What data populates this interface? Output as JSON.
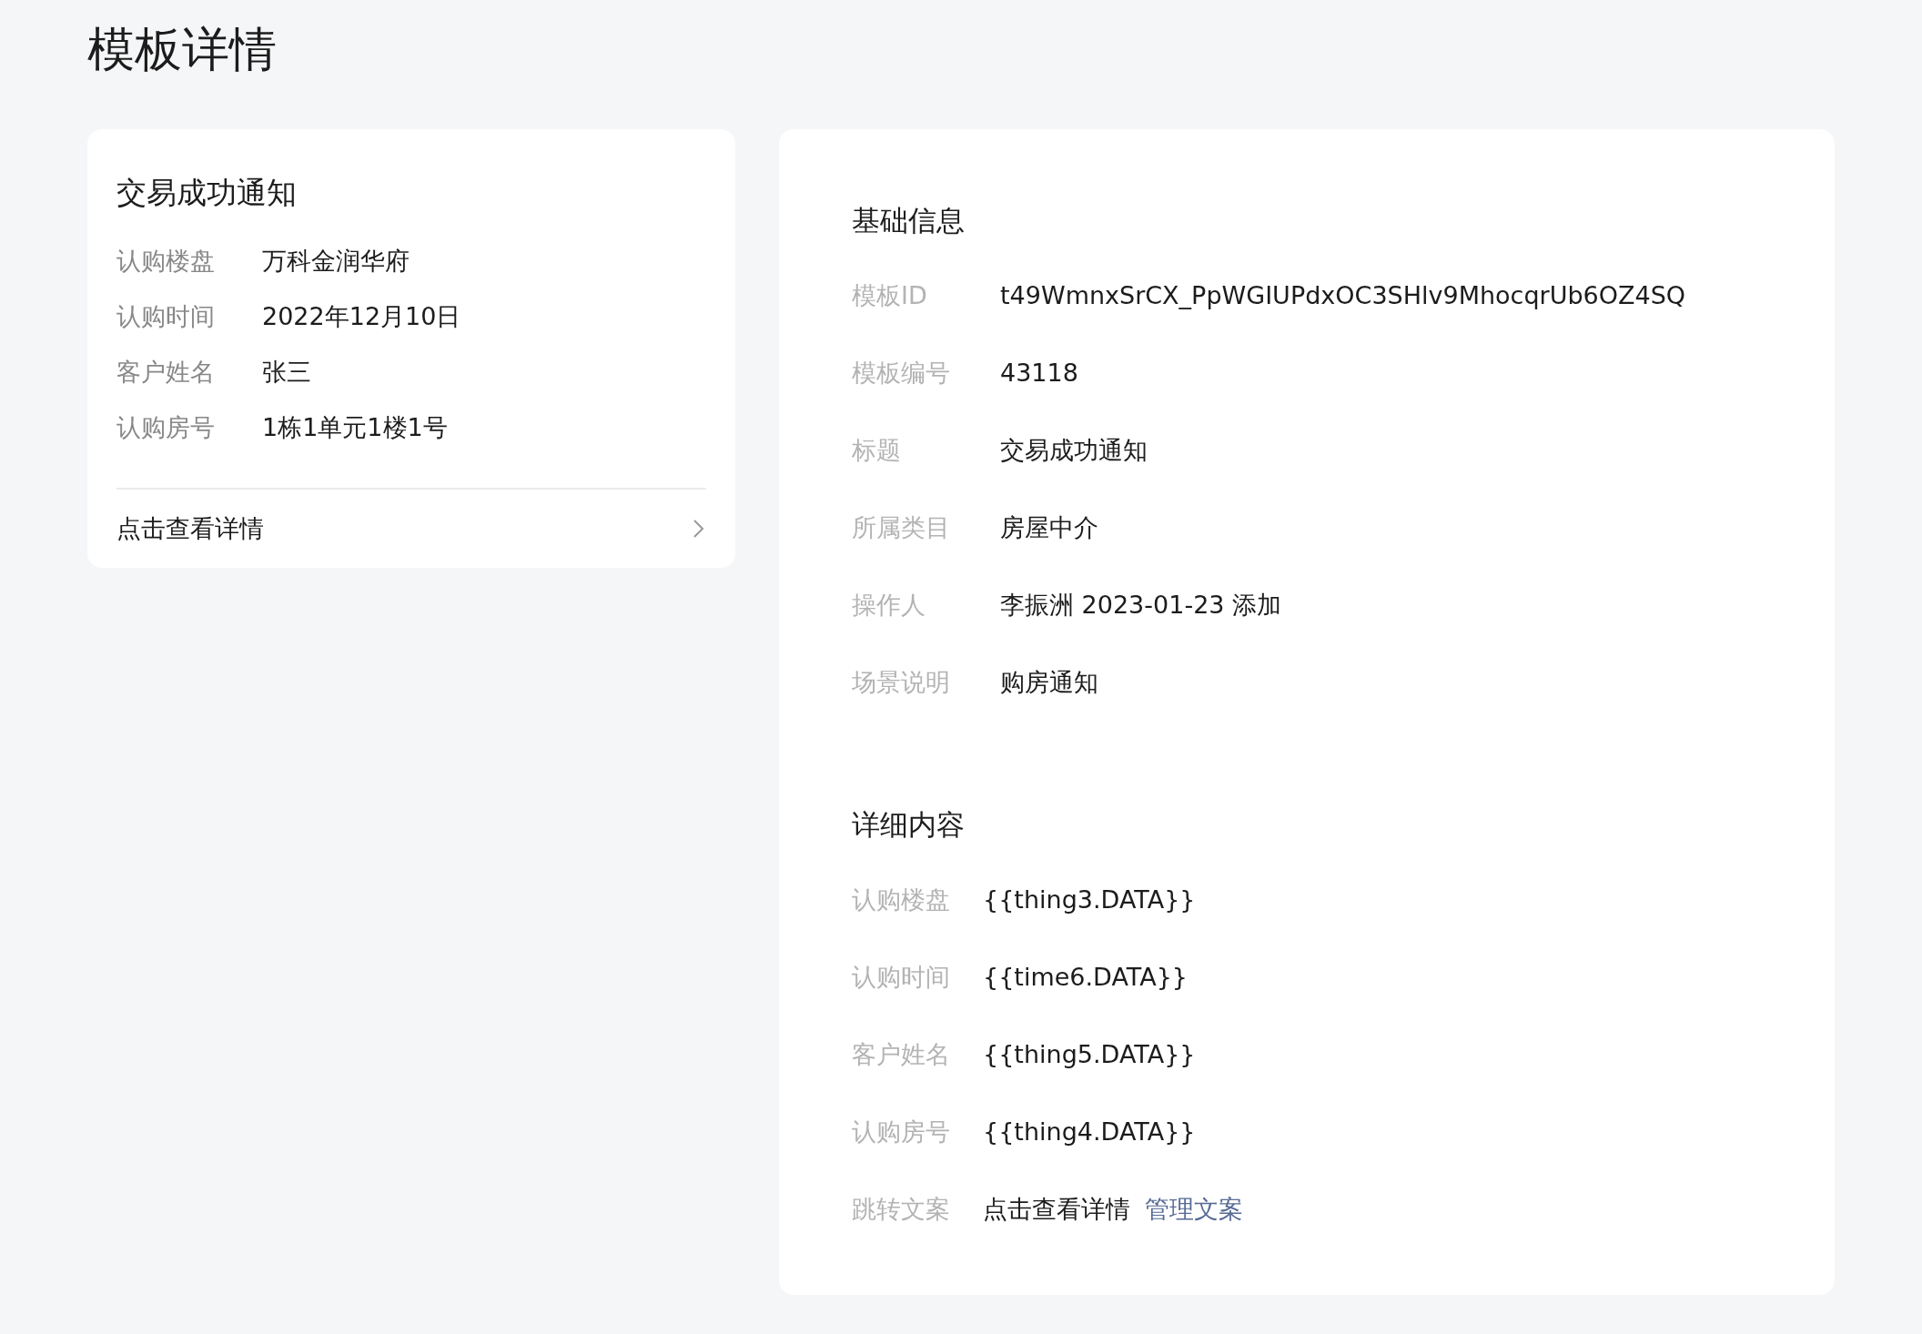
{
  "page_title": "模板详情",
  "preview": {
    "title": "交易成功通知",
    "fields": [
      {
        "label": "认购楼盘",
        "value": "万科金润华府"
      },
      {
        "label": "认购时间",
        "value": "2022年12月10日"
      },
      {
        "label": "客户姓名",
        "value": "张三"
      },
      {
        "label": "认购房号",
        "value": "1栋1单元1楼1号"
      }
    ],
    "link": "点击查看详情"
  },
  "basic_info": {
    "title": "基础信息",
    "fields": [
      {
        "label": "模板ID",
        "value": "t49WmnxSrCX_PpWGIUPdxOC3SHlv9MhocqrUb6OZ4SQ"
      },
      {
        "label": "模板编号",
        "value": "43118"
      },
      {
        "label": "标题",
        "value": "交易成功通知"
      },
      {
        "label": "所属类目",
        "value": "房屋中介"
      },
      {
        "label": "操作人",
        "value": "李振洲 2023-01-23 添加"
      },
      {
        "label": "场景说明",
        "value": "购房通知"
      }
    ]
  },
  "details": {
    "title": "详细内容",
    "fields": [
      {
        "label": "认购楼盘",
        "value": "{{thing3.DATA}}"
      },
      {
        "label": "认购时间",
        "value": "{{time6.DATA}}"
      },
      {
        "label": "客户姓名",
        "value": "{{thing5.DATA}}"
      },
      {
        "label": "认购房号",
        "value": "{{thing4.DATA}}"
      },
      {
        "label": "跳转文案",
        "value": "点击查看详情",
        "link": "管理文案"
      }
    ]
  }
}
